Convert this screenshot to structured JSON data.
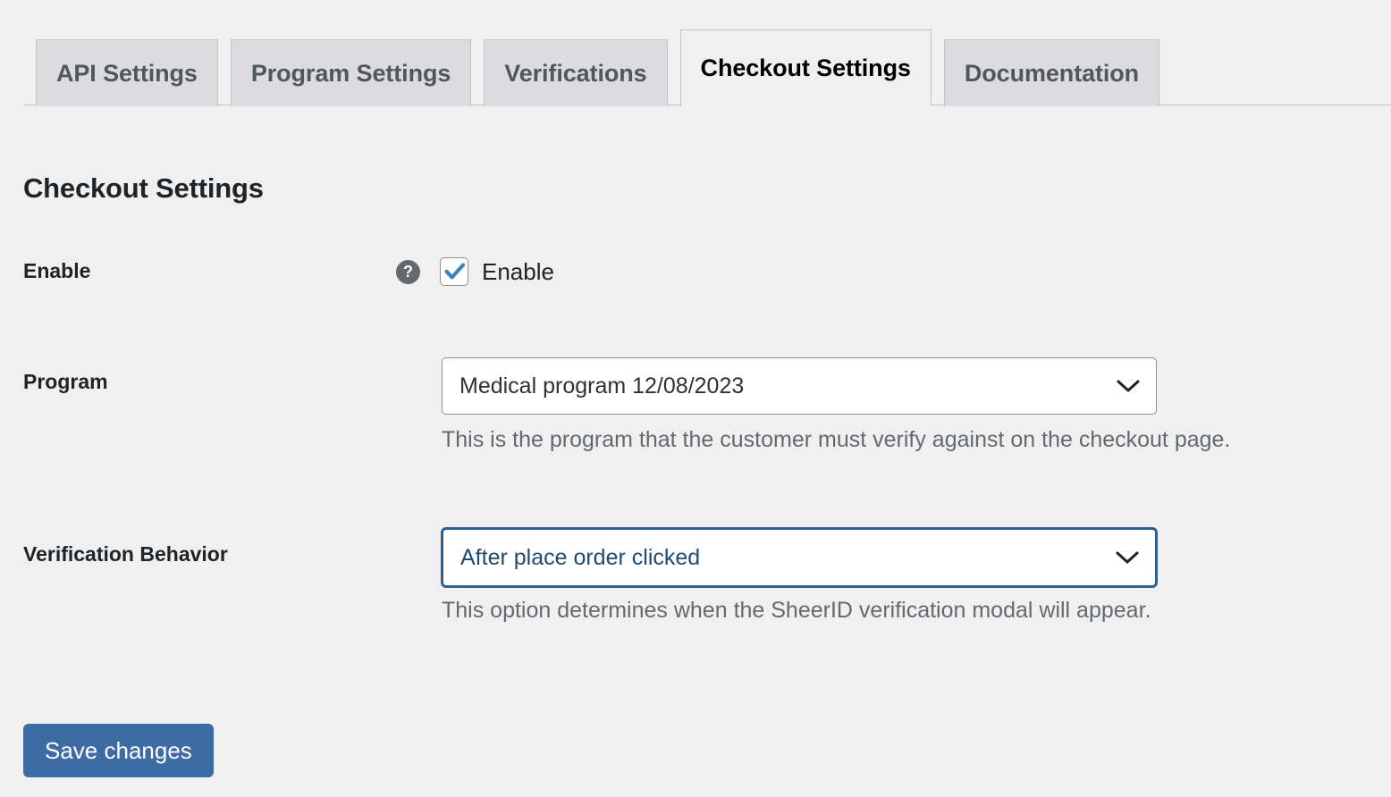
{
  "tabs": [
    {
      "label": "API Settings",
      "active": false
    },
    {
      "label": "Program Settings",
      "active": false
    },
    {
      "label": "Verifications",
      "active": false
    },
    {
      "label": "Checkout Settings",
      "active": true
    },
    {
      "label": "Documentation",
      "active": false
    }
  ],
  "page": {
    "title": "Checkout Settings"
  },
  "form": {
    "enable": {
      "label": "Enable",
      "help_icon": "question-mark-icon",
      "checkbox_label": "Enable",
      "checked": true
    },
    "program": {
      "label": "Program",
      "value": "Medical program 12/08/2023",
      "help_text": "This is the program that the customer must verify against on the checkout page.",
      "chevron_icon": "chevron-down-icon"
    },
    "verification_behavior": {
      "label": "Verification Behavior",
      "value": "After place order clicked",
      "help_text": "This option determines when the SheerID verification modal will appear.",
      "chevron_icon": "chevron-down-icon",
      "focused": true
    }
  },
  "actions": {
    "save_label": "Save changes"
  },
  "colors": {
    "page_background": "#f0f0f1",
    "tab_inactive_background": "#dcdcde",
    "border": "#c3c4c7",
    "accent_blue": "#3d6ba3",
    "focus_blue": "#2e5f94",
    "checkbox_blue": "#3582c4",
    "help_icon_gray": "#646970",
    "muted_text": "#646970"
  }
}
